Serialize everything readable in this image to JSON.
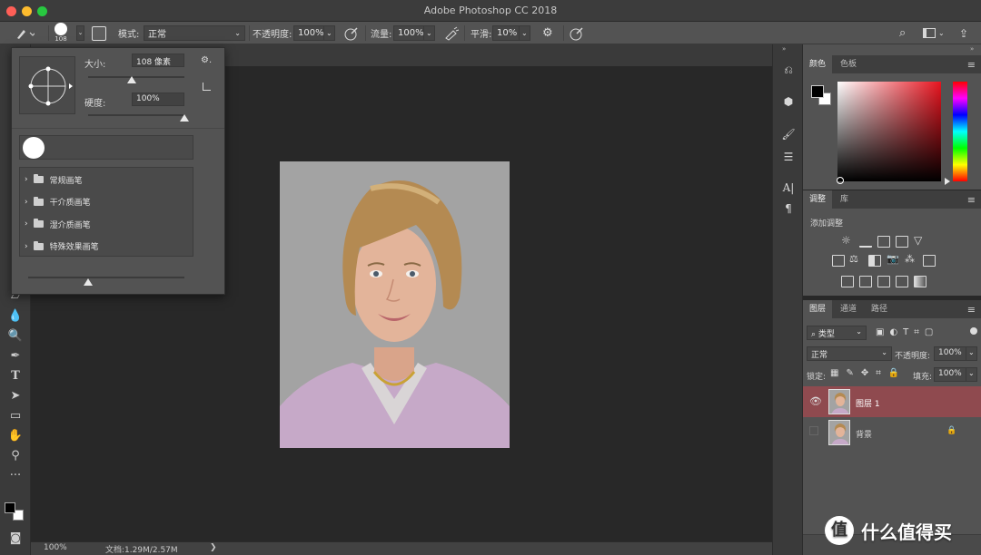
{
  "window": {
    "title": "Adobe Photoshop CC 2018"
  },
  "options_bar": {
    "brush_size": "108",
    "mode_label": "模式:",
    "mode_value": "正常",
    "opacity_label": "不透明度:",
    "opacity_value": "100%",
    "flow_label": "流量:",
    "flow_value": "100%",
    "smoothing_label": "平滑:",
    "smoothing_value": "10%"
  },
  "brush_popup": {
    "size_label": "大小:",
    "size_value": "108 像素",
    "size_level": 0.45,
    "hardness_label": "硬度:",
    "hardness_value": "100%",
    "hardness_level": 1.0,
    "folders": [
      "常规画笔",
      "干介质画笔",
      "湿介质画笔",
      "特殊效果画笔"
    ]
  },
  "status_bar": {
    "zoom": "100%",
    "doc_info": "文档:1.29M/2.57M"
  },
  "color_panel": {
    "tabs": [
      "颜色",
      "色板"
    ],
    "foreground": "#000000",
    "background": "#ffffff",
    "base_hue": "#e8141f"
  },
  "adjustments_panel": {
    "tabs": [
      "调整",
      "库"
    ],
    "add_label": "添加调整"
  },
  "layers_panel": {
    "tabs": [
      "图层",
      "通道",
      "路径"
    ],
    "filter_label": "类型",
    "blend_mode": "正常",
    "opacity_label": "不透明度:",
    "opacity_value": "100%",
    "lock_label": "锁定:",
    "fill_label": "填充:",
    "fill_value": "100%",
    "layers": [
      {
        "name": "图层 1",
        "visible": true,
        "selected": true,
        "locked": false
      },
      {
        "name": "背景",
        "visible": false,
        "selected": false,
        "locked": true
      }
    ]
  },
  "watermark": {
    "text": "什么值得买",
    "logo_glyph": "值"
  },
  "colors": {
    "selected_layer": "#8f4a4f",
    "panel_bg": "#535353",
    "canvas_bg": "#282828"
  }
}
